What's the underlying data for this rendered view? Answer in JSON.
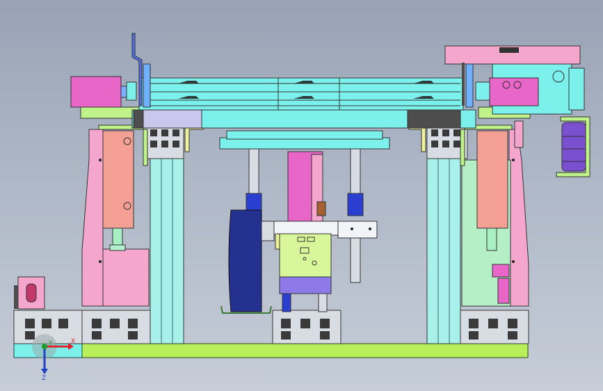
{
  "triad": {
    "x_label": "X",
    "y_label": "Y",
    "z_label": "Z",
    "colors": {
      "x": "#e0202a",
      "y": "#1f9e2f",
      "z": "#2040c8"
    }
  },
  "palette": {
    "background_top": "#97a3b5",
    "background_bottom": "#c6cdd8",
    "base_plate": "#b8ef5a",
    "aluminium_profile": "#d8dce3",
    "column": "#a8f0ea",
    "side_block_pink": "#f4a6cc",
    "side_block_salmon": "#f4a094",
    "top_beam": "#7cf0ea",
    "cylinder_magenta": "#e766c8",
    "roller_blue": "#24318f",
    "clamp_cyan": "#7ff1e6",
    "green_bracket": "#bff38a",
    "mint_panel": "#b4efc6",
    "purple_motor": "#7a50d0",
    "dark_gray": "#4d4d4d",
    "violet_block": "#8d79e8",
    "yellow_block": "#eef29a"
  },
  "components": [
    "base-plate",
    "aluminium-profile-left",
    "aluminium-profile-center",
    "aluminium-profile-right",
    "left-column",
    "right-column",
    "top-beam-stack",
    "left-side-block",
    "right-side-block",
    "left-pneumatic-cylinder",
    "right-pneumatic-cylinder",
    "guide-rod-left",
    "guide-rod-right",
    "center-lifting-cylinder",
    "blue-roller",
    "purple-motor",
    "right-top-bracket",
    "left-edge-fixture"
  ]
}
